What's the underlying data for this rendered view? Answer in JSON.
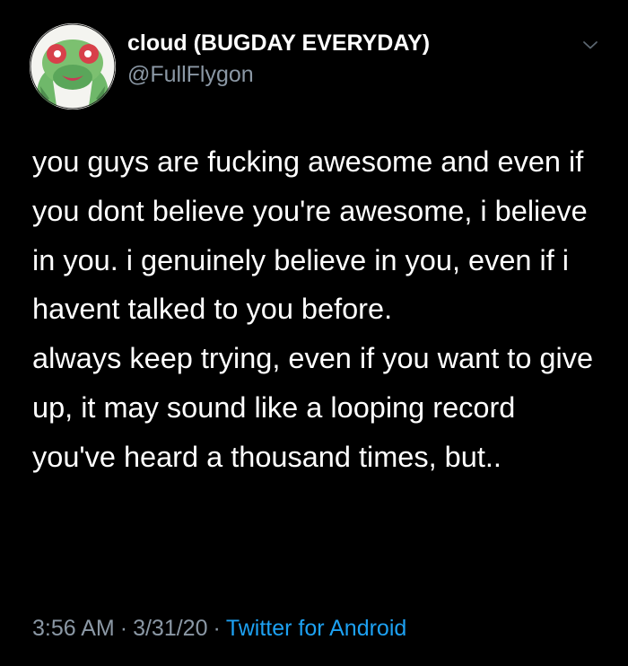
{
  "author": {
    "display_name": "cloud (BUGDAY EVERYDAY)",
    "handle": "@FullFlygon",
    "avatar_icon": "flygon-avatar-icon"
  },
  "tweet": {
    "paragraph_1": "you guys are fucking awesome and even if you dont believe you're awesome, i believe in you. i genuinely believe in you, even if i havent talked to you before.",
    "paragraph_2": "always keep trying, even if you want to give up, it may sound like a looping record you've heard a thousand times, but.."
  },
  "meta": {
    "time": "3:56 AM",
    "date": "3/31/20",
    "separator": "·",
    "source": "Twitter for Android"
  },
  "colors": {
    "background": "#000000",
    "text": "#ffffff",
    "secondary": "#8b98a5",
    "link": "#1da1f2"
  }
}
